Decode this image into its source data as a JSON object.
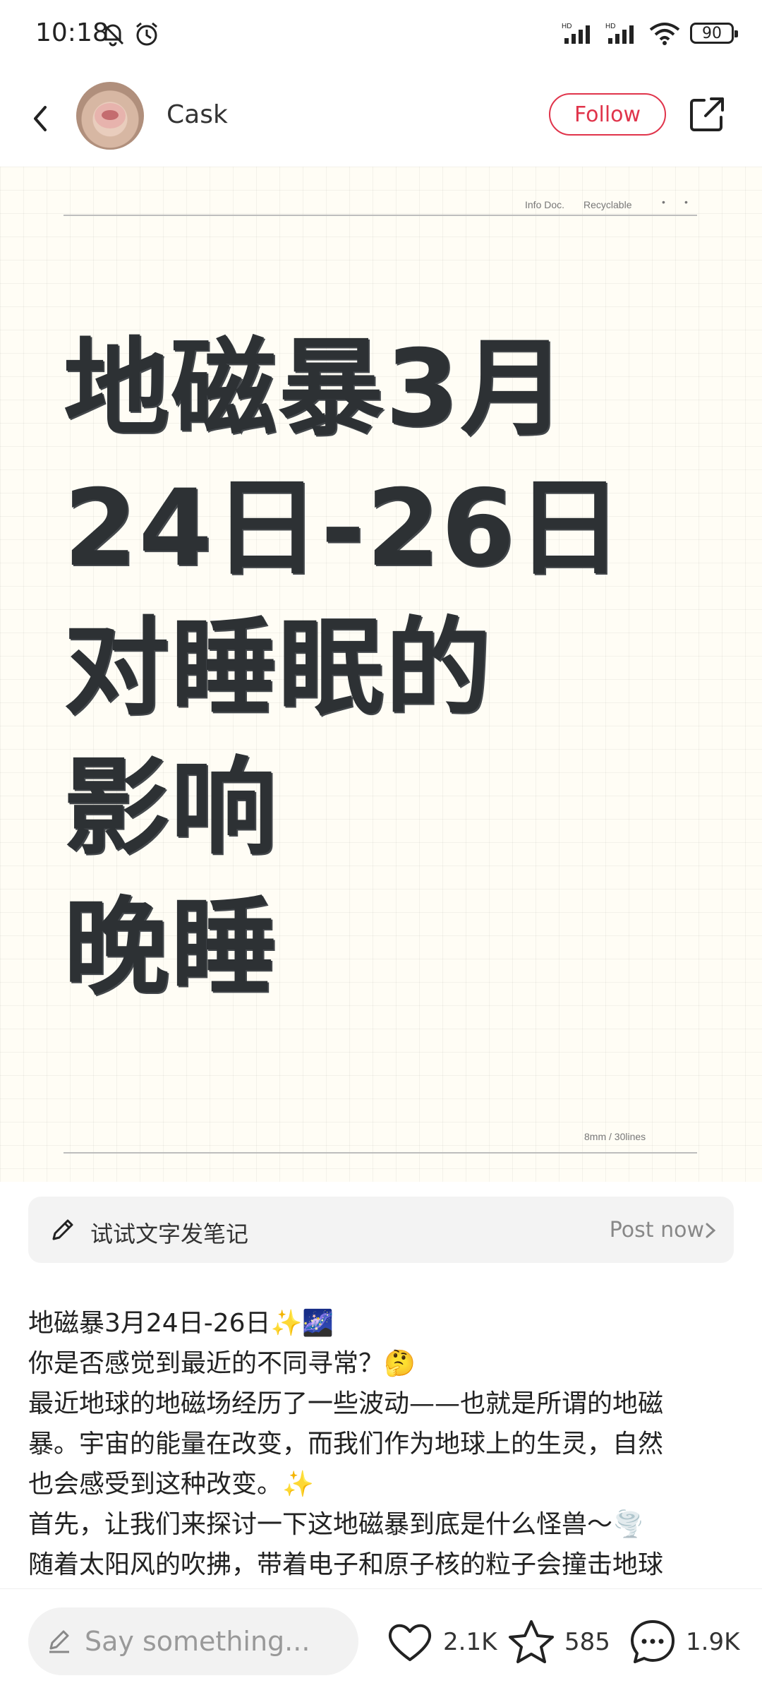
{
  "status_bar": {
    "time": "10:18",
    "battery": "90"
  },
  "header": {
    "username": "Cask",
    "follow_label": "Follow"
  },
  "cover": {
    "meta_left": "Info Doc.",
    "meta_right": "Recyclable",
    "footer": "8mm / 30lines",
    "title_lines": [
      "地磁暴3月",
      "24日-26日",
      "对睡眠的",
      "影响",
      "晚睡"
    ]
  },
  "post_bar": {
    "prompt": "试试文字发笔记",
    "action": "Post now"
  },
  "article": {
    "lines": [
      "地磁暴3月24日-26日✨🌌",
      "你是否感觉到最近的不同寻常？🤔",
      "最近地球的地磁场经历了一些波动——也就是所谓的地磁",
      "暴。宇宙的能量在改变，而我们作为地球上的生灵，自然",
      "也会感受到这种改变。✨",
      "首先，让我们来探讨一下这地磁暴到底是什么怪兽～🌪️",
      "随着太阳风的吹拂，带着电子和原子核的粒子会撞击地球"
    ]
  },
  "bottom_bar": {
    "placeholder": "Say something...",
    "likes": "2.1K",
    "collects": "585",
    "comments": "1.9K"
  }
}
